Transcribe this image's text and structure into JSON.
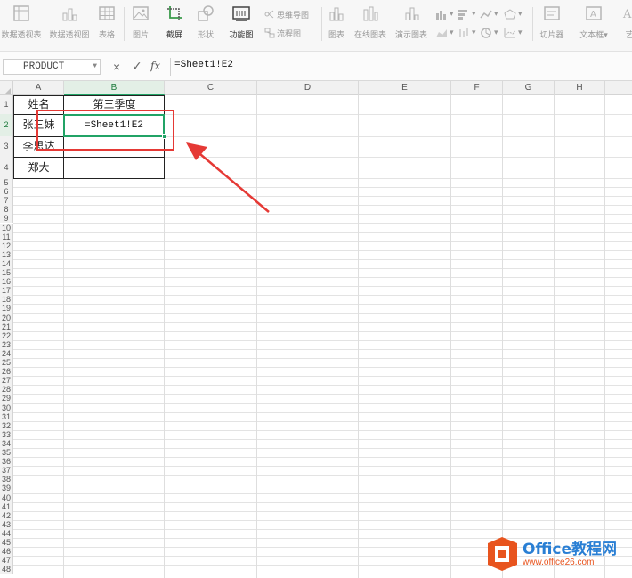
{
  "ribbon": {
    "buttons": [
      {
        "label": "数据透视表",
        "icon": "pivot-table-icon"
      },
      {
        "label": "数据透视图",
        "icon": "pivot-chart-icon"
      },
      {
        "label": "表格",
        "icon": "table-icon"
      },
      {
        "label": "图片",
        "icon": "picture-icon"
      },
      {
        "label": "截屏",
        "icon": "screenshot-icon"
      },
      {
        "label": "形状",
        "icon": "shapes-icon"
      },
      {
        "label": "功能图",
        "icon": "function-chart-icon"
      },
      {
        "label": "图表",
        "icon": "chart-icon"
      },
      {
        "label": "在线图表",
        "icon": "online-chart-icon"
      },
      {
        "label": "演示图表",
        "icon": "demo-chart-icon"
      },
      {
        "label": "切片器",
        "icon": "slicer-icon"
      },
      {
        "label": "文本框",
        "icon": "textbox-icon"
      },
      {
        "label": "艺",
        "icon": "wordart-icon"
      }
    ],
    "small": {
      "mind_map": "思维导图",
      "flowchart": "流程图"
    }
  },
  "formula_bar": {
    "name_box": "PRODUCT",
    "fx": "fx",
    "cancel": "×",
    "confirm": "✓",
    "formula": "=Sheet1!E2"
  },
  "grid": {
    "columns": [
      "A",
      "B",
      "C",
      "D",
      "E",
      "F",
      "G",
      "H"
    ],
    "rows": [
      "1",
      "2",
      "3",
      "4",
      "5",
      "6",
      "7",
      "8",
      "9",
      "10",
      "11",
      "12",
      "13",
      "14",
      "15",
      "16",
      "17",
      "18",
      "19",
      "20",
      "21",
      "22",
      "23",
      "24",
      "25",
      "26",
      "27",
      "28",
      "29",
      "30",
      "31",
      "32",
      "33",
      "34",
      "35",
      "36",
      "37",
      "38",
      "39",
      "40",
      "41",
      "42",
      "43",
      "44",
      "45",
      "46",
      "47",
      "48"
    ],
    "cells": {
      "A1": "姓名",
      "B1": "第三季度",
      "A2": "张三妹",
      "B2": "=Sheet1!E2",
      "A3": "李思达",
      "A4": "郑大"
    }
  },
  "watermark": {
    "brand": "Office教程网",
    "url": "www.office26.com",
    "colors": {
      "orange": "#e8541e",
      "blue": "#2a7fd4"
    }
  },
  "colors": {
    "annotation_red": "#e53935",
    "active_green": "#21a366"
  }
}
